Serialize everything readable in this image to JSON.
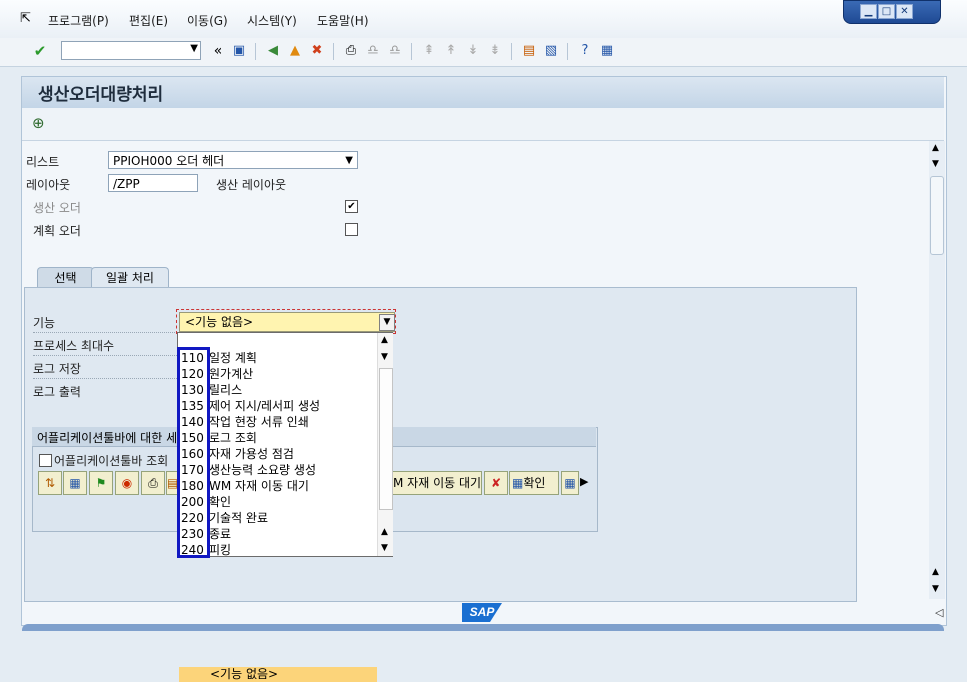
{
  "menu": {
    "items": [
      "프로그램(P)",
      "편집(E)",
      "이동(G)",
      "시스템(Y)",
      "도움말(H)"
    ]
  },
  "window_controls": {
    "minimize": "▁",
    "maximize": "□",
    "close": "✕"
  },
  "toolbar": {
    "command_field": "",
    "history_nav": "«"
  },
  "page": {
    "title": "생산오더대량처리"
  },
  "form": {
    "list_label": "리스트",
    "list_value": "PPIOH000 오더 헤더",
    "layout_label": "레이아웃",
    "layout_value": "/ZPP",
    "layout_desc": "생산 레이아웃",
    "production_order_label": "생산 오더",
    "production_order_checked": true,
    "planned_order_label": "계획 오더",
    "planned_order_checked": false
  },
  "tabs": [
    {
      "label": "선택",
      "active": false
    },
    {
      "label": "일괄 처리",
      "active": true
    }
  ],
  "batch": {
    "function_label": "기능",
    "function_value": "<기능 없음>",
    "max_processes_label": "프로세스 최대수",
    "save_log_label": "로그 저장",
    "log_output_label": "로그 출력",
    "app_toolbar_group_title": "어플리케이션툴바에 대한 세",
    "app_toolbar_view_label": "어플리케이션툴바 조회",
    "app_toolbar_view_checked": false,
    "wm_button_label": "M 자재 이동 대기",
    "confirm_button_label": "확인"
  },
  "dropdown": {
    "header": "<기능 없음>",
    "options": [
      {
        "key": "110",
        "text": "일정 계획"
      },
      {
        "key": "120",
        "text": "원가계산"
      },
      {
        "key": "130",
        "text": "릴리스"
      },
      {
        "key": "135",
        "text": "제어 지시/레서피 생성"
      },
      {
        "key": "140",
        "text": "작업 현장 서류 인쇄"
      },
      {
        "key": "150",
        "text": "로그 조회"
      },
      {
        "key": "160",
        "text": "자재 가용성 점검"
      },
      {
        "key": "170",
        "text": "생산능력 소요량 생성"
      },
      {
        "key": "180",
        "text": "WM 자재 이동 대기"
      },
      {
        "key": "200",
        "text": "확인"
      },
      {
        "key": "220",
        "text": "기술적 완료"
      },
      {
        "key": "230",
        "text": "종료"
      },
      {
        "key": "240",
        "text": "피킹"
      }
    ]
  },
  "footer": {
    "logo": "SAP"
  },
  "colors": {
    "accent": "#1118c2",
    "dropdown_highlight": "#fcd47a",
    "combo_bg": "#fff4b0"
  }
}
